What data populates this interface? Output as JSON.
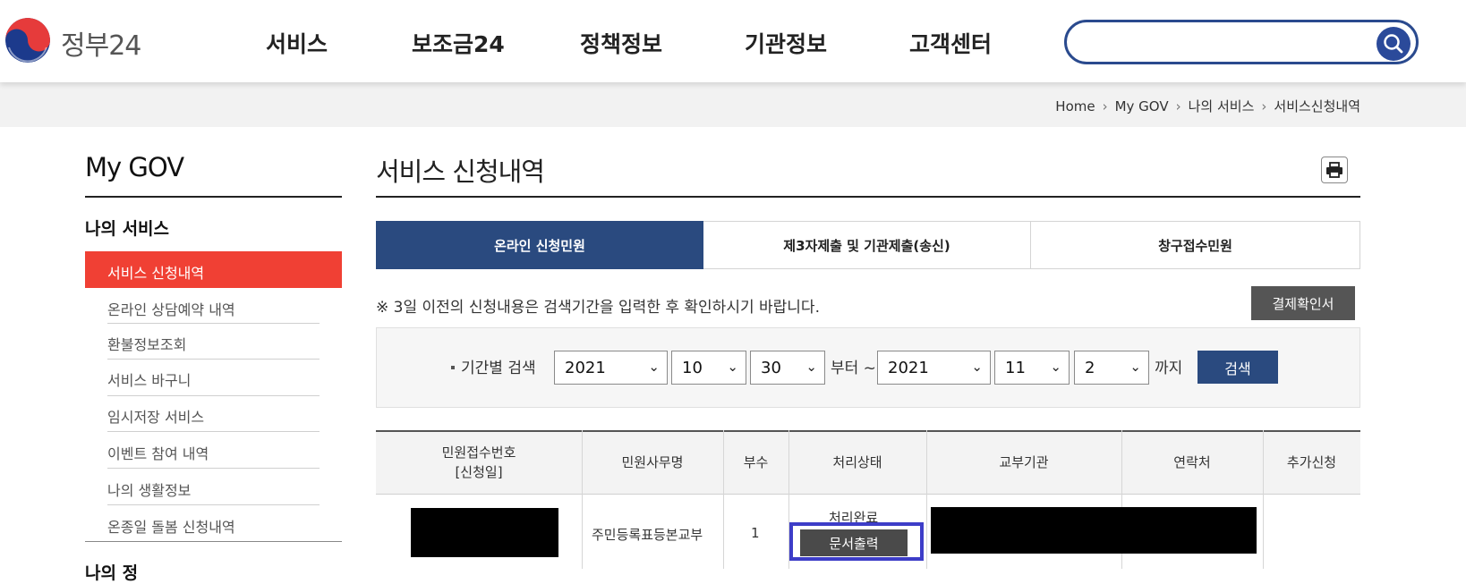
{
  "header": {
    "logo_text": "정부24",
    "nav": [
      "서비스",
      "보조금24",
      "정책정보",
      "기관정보",
      "고객센터"
    ],
    "search": {
      "value": "",
      "placeholder": ""
    }
  },
  "breadcrumb": [
    "Home",
    "My GOV",
    "나의 서비스",
    "서비스신청내역"
  ],
  "sidebar": {
    "title": "My GOV",
    "section": "나의 서비스",
    "items": [
      "서비스 신청내역",
      "온라인 상담예약 내역",
      "환불정보조회",
      "서비스 바구니",
      "임시저장 서비스",
      "이벤트 참여 내역",
      "나의 생활정보",
      "온종일 돌봄 신청내역"
    ],
    "active_index": 0,
    "next_section_partial": "나의 정"
  },
  "main": {
    "title": "서비스 신청내역",
    "tabs": [
      "온라인 신청민원",
      "제3자제출 및 기관제출(송신)",
      "창구접수민원"
    ],
    "active_tab": 0,
    "notice": "※ 3일 이전의 신청내용은 검색기간을 입력한 후 확인하시기 바랍니다.",
    "receipt_button": "결제확인서",
    "filter": {
      "label": "기간별 검색",
      "from": {
        "year": "2021",
        "month": "10",
        "day": "30"
      },
      "from_suffix": "부터 ~",
      "to": {
        "year": "2021",
        "month": "11",
        "day": "2"
      },
      "to_suffix": "까지",
      "submit": "검색"
    },
    "table": {
      "headers": [
        "민원접수번호\n[신청일]",
        "민원사무명",
        "부수",
        "처리상태",
        "교부기관",
        "연락처",
        "추가신청"
      ],
      "rows": [
        {
          "service_name": "주민등록표등본교부",
          "copies": "1",
          "status": "처리완료",
          "print_button": "문서출력"
        }
      ]
    }
  },
  "colors": {
    "primary": "#2a4a7f",
    "active_sidebar": "#f04034",
    "highlight": "#3d3dc8"
  }
}
